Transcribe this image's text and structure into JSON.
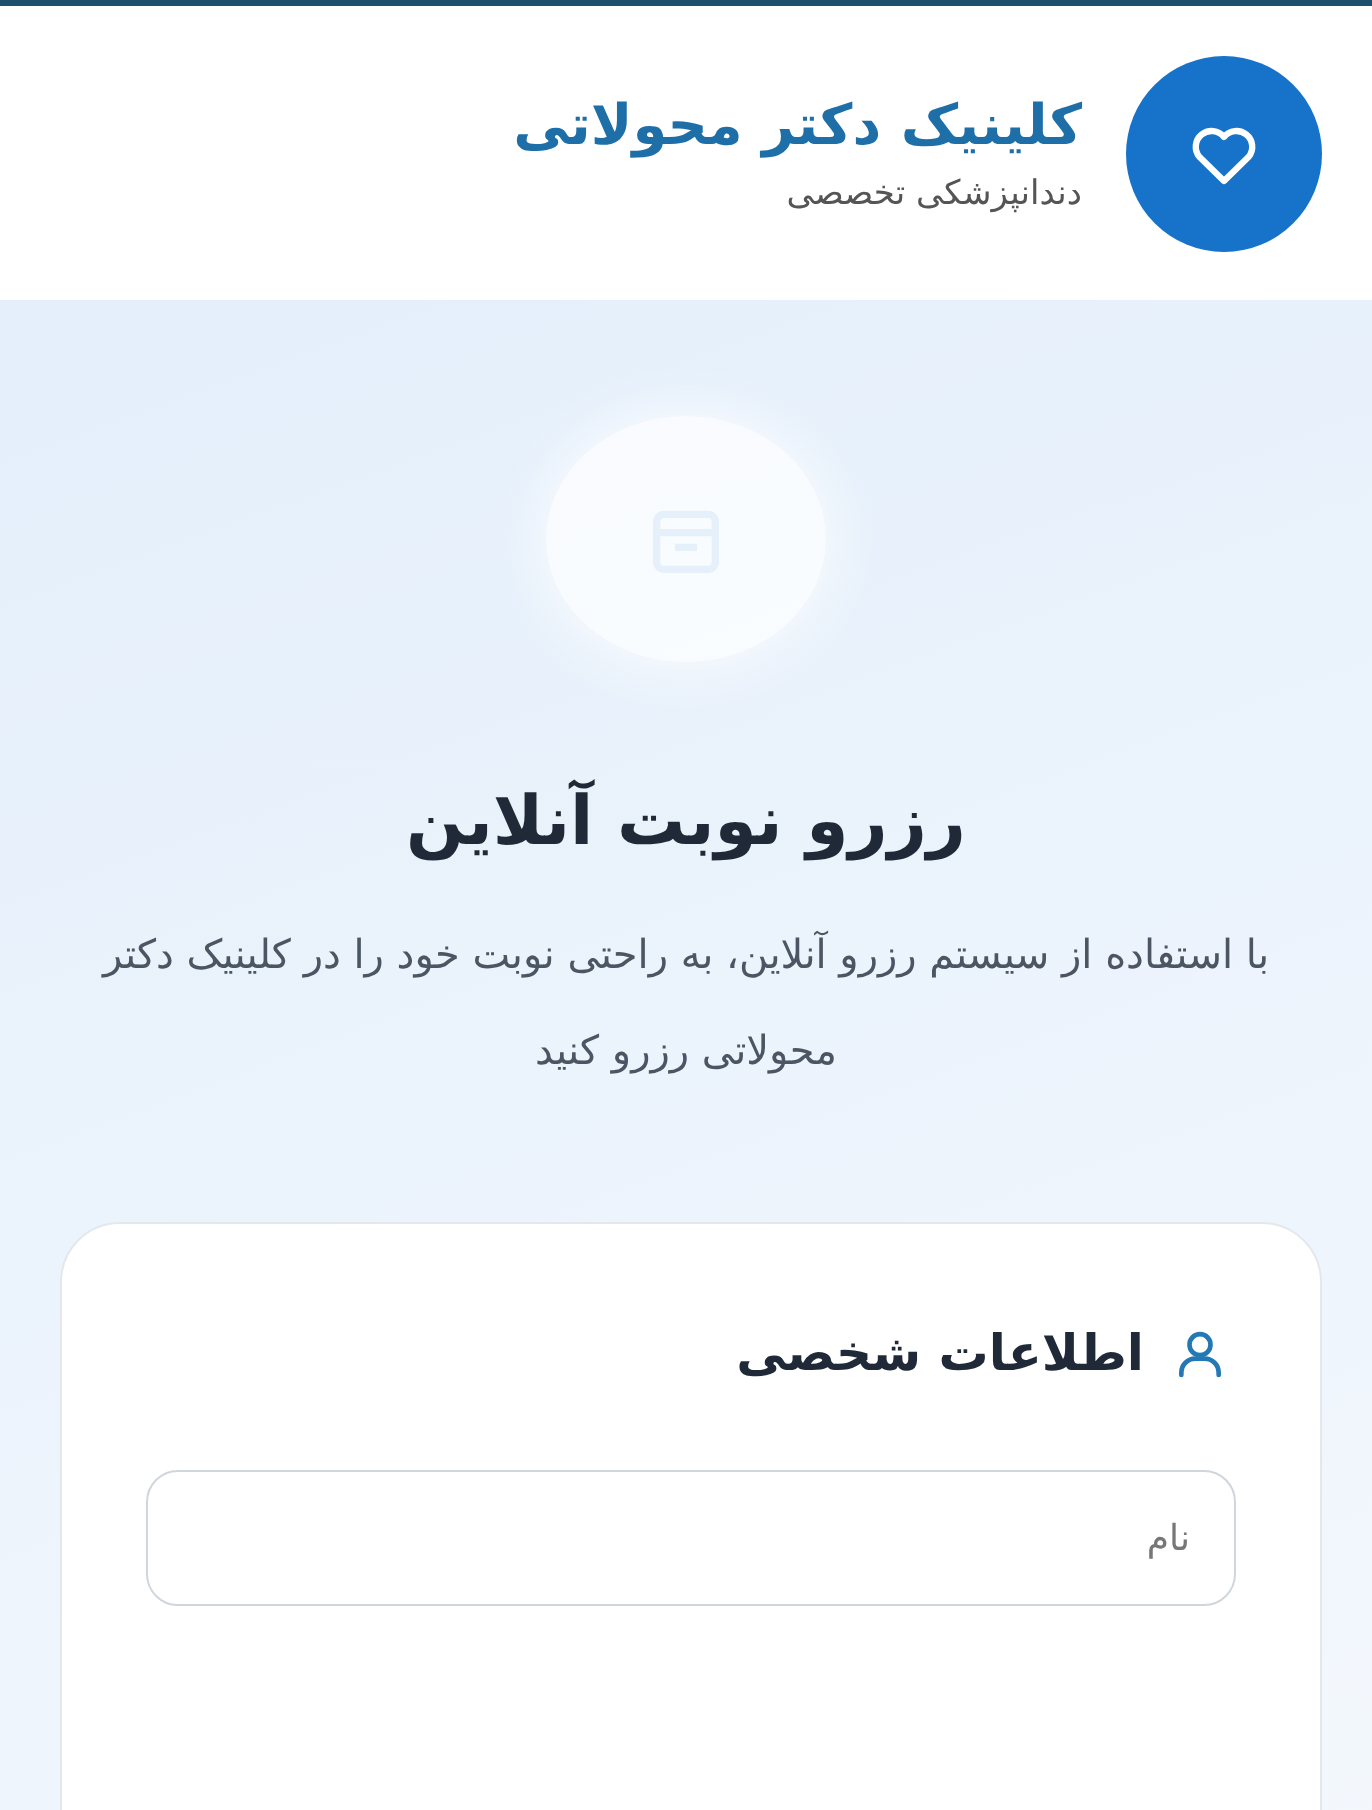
{
  "header": {
    "title": "کلینیک دکتر محولاتی",
    "subtitle": "دندانپزشکی تخصصی"
  },
  "hero": {
    "title": "رزرو نوبت آنلاین",
    "description": "با استفاده از سیستم رزرو آنلاین، به راحتی نوبت خود را در کلینیک دکتر محولاتی رزرو کنید"
  },
  "form": {
    "section_title": "اطلاعات شخصی",
    "fields": [
      {
        "placeholder": "نام"
      }
    ]
  }
}
